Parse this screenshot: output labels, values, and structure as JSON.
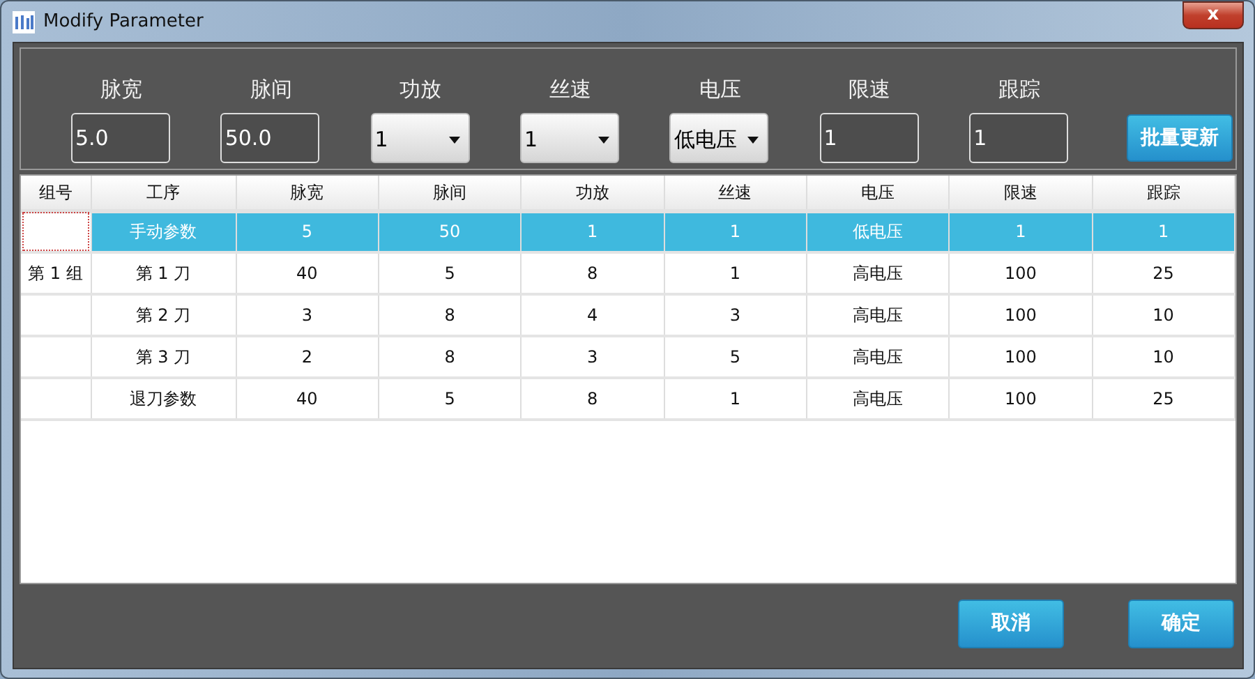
{
  "window": {
    "title": "Modify Parameter",
    "close": "x"
  },
  "params": [
    {
      "label": "脉宽",
      "kind": "input",
      "value": "5.0"
    },
    {
      "label": "脉间",
      "kind": "input",
      "value": "50.0"
    },
    {
      "label": "功放",
      "kind": "select",
      "value": "1"
    },
    {
      "label": "丝速",
      "kind": "select",
      "value": "1"
    },
    {
      "label": "电压",
      "kind": "select",
      "value": "低电压"
    },
    {
      "label": "限速",
      "kind": "input",
      "value": "1"
    },
    {
      "label": "跟踪",
      "kind": "input",
      "value": "1"
    }
  ],
  "batch_button": "批量更新",
  "table": {
    "columns": [
      "组号",
      "工序",
      "脉宽",
      "脉间",
      "功放",
      "丝速",
      "电压",
      "限速",
      "跟踪"
    ],
    "rows": [
      {
        "selected": true,
        "focused": true,
        "cells": [
          "",
          "手动参数",
          "5",
          "50",
          "1",
          "1",
          "低电压",
          "1",
          "1"
        ]
      },
      {
        "selected": false,
        "focused": false,
        "cells": [
          "第 1 组",
          "第 1 刀",
          "40",
          "5",
          "8",
          "1",
          "高电压",
          "100",
          "25"
        ]
      },
      {
        "selected": false,
        "focused": false,
        "cells": [
          "",
          "第 2 刀",
          "3",
          "8",
          "4",
          "3",
          "高电压",
          "100",
          "10"
        ]
      },
      {
        "selected": false,
        "focused": false,
        "cells": [
          "",
          "第 3 刀",
          "2",
          "8",
          "3",
          "5",
          "高电压",
          "100",
          "10"
        ]
      },
      {
        "selected": false,
        "focused": false,
        "cells": [
          "",
          "退刀参数",
          "40",
          "5",
          "8",
          "1",
          "高电压",
          "100",
          "25"
        ]
      }
    ]
  },
  "buttons": [
    "取消",
    "确定"
  ]
}
